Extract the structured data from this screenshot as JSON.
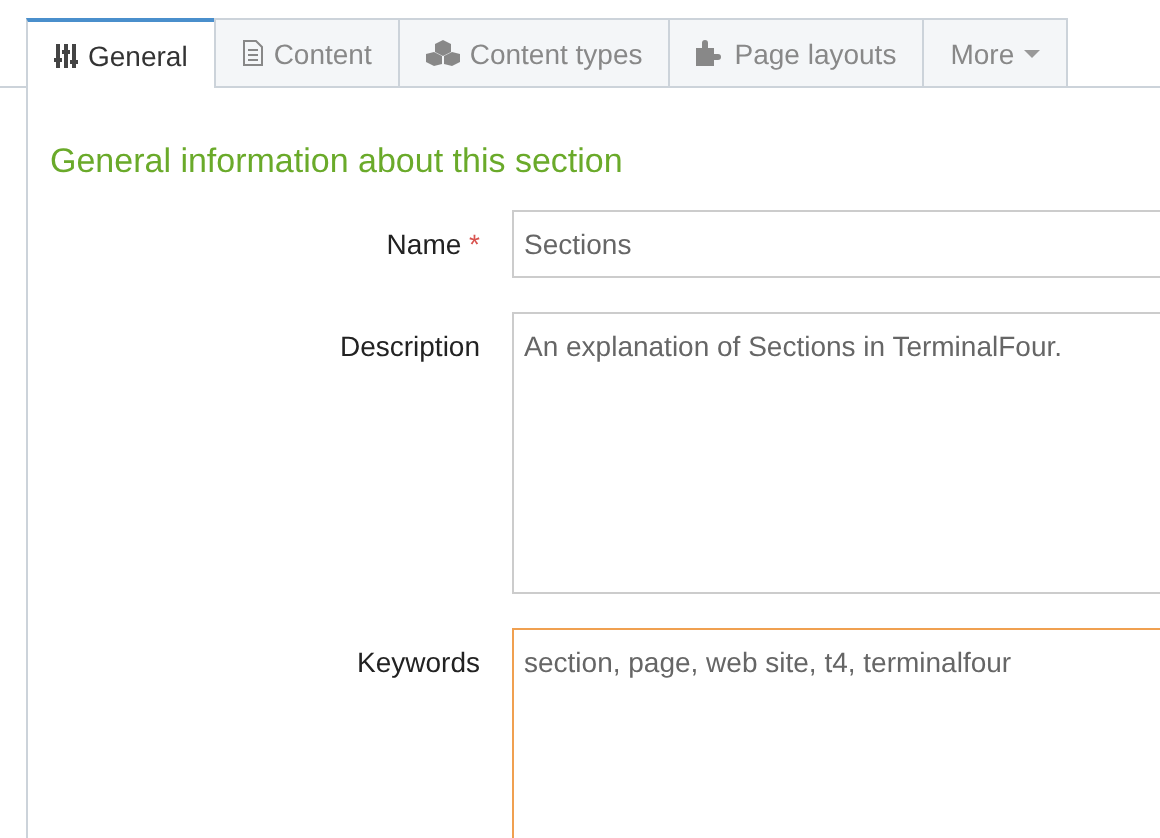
{
  "tabs": [
    {
      "label": "General",
      "kind": "tab",
      "selected": true
    },
    {
      "label": "Content",
      "kind": "tab",
      "selected": false
    },
    {
      "label": "Content types",
      "kind": "tab",
      "selected": false
    },
    {
      "label": "Page layouts",
      "kind": "tab",
      "selected": false
    },
    {
      "label": "More",
      "kind": "menu",
      "selected": false
    }
  ],
  "section_title": "General information about this section",
  "fields": [
    {
      "label": "Name",
      "required_mark": "*",
      "kind": "input",
      "value": "Sections",
      "focused": false
    },
    {
      "label": "Description",
      "kind": "textarea",
      "value": "An explanation of Sections in TerminalFour.",
      "focused": false
    },
    {
      "label": "Keywords",
      "kind": "textarea",
      "value": "section, page, web site, t4, terminalfour",
      "focused": true
    }
  ]
}
